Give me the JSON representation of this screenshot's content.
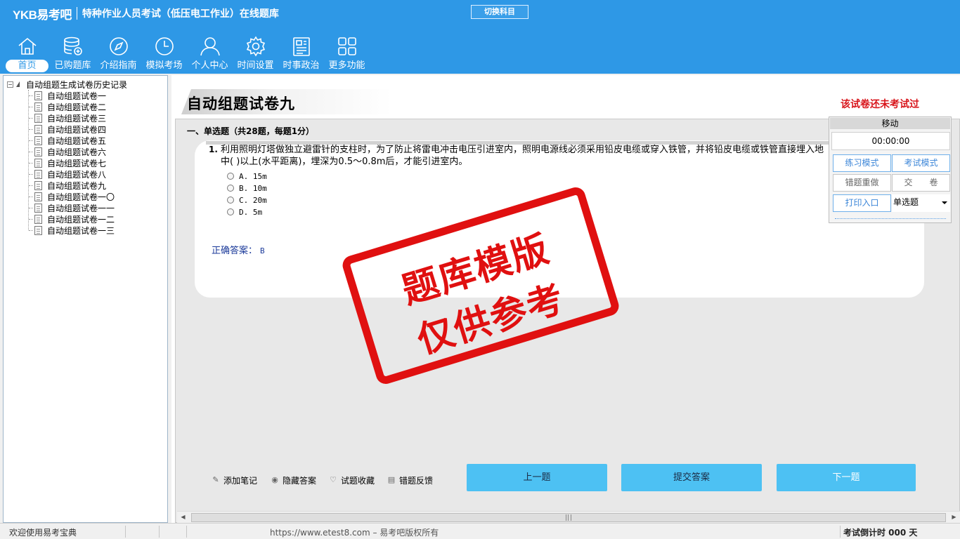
{
  "header": {
    "logo": "YKB易考吧",
    "title": "特种作业人员考试（低压电工作业）在线题库",
    "switch_button": "切换科目"
  },
  "nav": {
    "items": [
      {
        "label": "首页",
        "icon": "home-icon"
      },
      {
        "label": "已购题库",
        "icon": "database-icon"
      },
      {
        "label": "介绍指南",
        "icon": "compass-icon"
      },
      {
        "label": "模拟考场",
        "icon": "clock-icon"
      },
      {
        "label": "个人中心",
        "icon": "user-icon"
      },
      {
        "label": "时间设置",
        "icon": "gear-icon"
      },
      {
        "label": "时事政治",
        "icon": "newspaper-icon"
      },
      {
        "label": "更多功能",
        "icon": "grid-icon"
      }
    ],
    "active_index": 0
  },
  "tree": {
    "root_label": "自动组题生成试卷历史记录",
    "items": [
      {
        "label": "自动组题试卷一"
      },
      {
        "label": "自动组题试卷二"
      },
      {
        "label": "自动组题试卷三"
      },
      {
        "label": "自动组题试卷四"
      },
      {
        "label": "自动组题试卷五"
      },
      {
        "label": "自动组题试卷六"
      },
      {
        "label": "自动组题试卷七"
      },
      {
        "label": "自动组题试卷八"
      },
      {
        "label": "自动组题试卷九"
      },
      {
        "label": "自动组题试卷一〇"
      },
      {
        "label": "自动组题试卷一一"
      },
      {
        "label": "自动组题试卷一二"
      },
      {
        "label": "自动组题试卷一三"
      }
    ],
    "selected_index": 8
  },
  "main": {
    "paper_title": "自动组题试卷九",
    "status_note": "该试卷还未考试过",
    "section_heading": "一、单选题（共28题，每题1分）",
    "question": {
      "number": "1.",
      "text": "利用照明灯塔做独立避雷针的支柱时，为了防止将雷电冲击电压引进室内，照明电源线必须采用铅皮电缆或穿入铁管，并将铅皮电缆或铁管直接埋入地中( )以上(水平距离)，埋深为0.5～0.8m后，才能引进室内。",
      "options": [
        {
          "label": "A. 15m"
        },
        {
          "label": "B. 10m"
        },
        {
          "label": "C. 20m"
        },
        {
          "label": "D. 5m"
        }
      ],
      "answer_label": "正确答案：",
      "answer_value": "B"
    },
    "stamp": {
      "line1": "题库模版",
      "line2": "仅供参考"
    },
    "tools": {
      "add_note": "添加笔记",
      "hide_answer": "隐藏答案",
      "favorite": "试题收藏",
      "feedback": "错题反馈"
    },
    "buttons": {
      "prev": "上一题",
      "submit": "提交答案",
      "next": "下一题"
    }
  },
  "float_panel": {
    "move_label": "移动",
    "timer": "00:00:00",
    "practice_mode": "练习模式",
    "exam_mode": "考试模式",
    "redo_wrong": "错题重做",
    "hand_in": "交　　卷",
    "print_entry": "打印入口",
    "question_type": "单选题"
  },
  "status_bar": {
    "welcome": "欢迎使用易考宝典",
    "url": "https://www.etest8.com – 易考吧版权所有",
    "countdown": "考试倒计时 000 天"
  }
}
